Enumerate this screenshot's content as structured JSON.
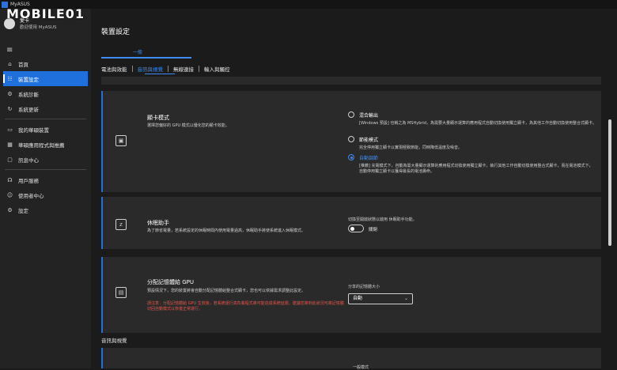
{
  "app": {
    "title": "MyASUS",
    "watermark": "MOBILE01"
  },
  "user": {
    "name": "愛卡",
    "subtitle": "歡迎使用 MyASUS"
  },
  "sidebar": {
    "group1": [
      {
        "label": "首頁",
        "icon": "home-icon"
      },
      {
        "label": "裝置設定",
        "icon": "sliders-icon",
        "active": true
      },
      {
        "label": "系統診斷",
        "icon": "wrench-icon"
      },
      {
        "label": "系統更新",
        "icon": "refresh-icon"
      }
    ],
    "group2": [
      {
        "label": "我的華碩裝置",
        "icon": "devices-icon"
      },
      {
        "label": "華碩應用程式與推薦",
        "icon": "grid-icon"
      },
      {
        "label": "訊息中心",
        "icon": "message-icon"
      }
    ],
    "group3": [
      {
        "label": "用戶服務",
        "icon": "headset-icon"
      },
      {
        "label": "使用者中心",
        "icon": "person-icon"
      },
      {
        "label": "設定",
        "icon": "gear-icon"
      }
    ]
  },
  "main": {
    "page_title": "裝置設定",
    "general_label": "一般",
    "tabs": [
      "電池與效能",
      "音訊與視覺",
      "無線連接",
      "輸入與觸控"
    ],
    "active_tab": 1,
    "gpu_card": {
      "title": "顯卡模式",
      "desc": "選擇您偏好的 GPU 模式以優化您的顯卡效能。",
      "options": [
        {
          "label": "混合輸出",
          "desc": "[Windows 預設] 也稱之為 MSHybrid，為需要大量顯示運算的應用程式自動切換使用獨立顯卡，為其他工作自動切換使用整合式顯卡。"
        },
        {
          "label": "節能模式",
          "desc": "完全停用獨立顯卡以實現極致節能，同時降低溫度及噪音。"
        },
        {
          "label": "自動調節",
          "desc": "[推薦] 充電模式下，自動為需大量顯示運算的應用程式切換使用獨立顯卡，執行其他工作自動切換使用整合式顯卡，而在電池模式下，自動停用獨立顯卡以獲得最長的電池壽命。",
          "selected": true
        }
      ]
    },
    "sleep_card": {
      "title": "休眠助手",
      "desc": "為了節省電量，若系統設定的休眠時間內使用電量過高，休眠助手將使系統進入休眠模式。",
      "right_label": "切換至開啟狀態以啟用 休眠助手功能。",
      "toggle_label": "關閉"
    },
    "memory_card": {
      "title": "分配記憶體給 GPU",
      "desc": "預設情況下，您的裝置將會自動分配記憶體給整合式顯卡，您也可以依據需求調整此設定。",
      "warning": "請注意：分配記憶體給 GPU 生效後，若系統運行高負載程式將可能造成系統延遲，建議您將到此狀況可將記憶體切回自動模式以恢復正常運行。",
      "select_label": "分享的記憶體大小",
      "select_value": "自動"
    },
    "section_title": "音訊與視覺",
    "bottom_text": "一般模式"
  }
}
